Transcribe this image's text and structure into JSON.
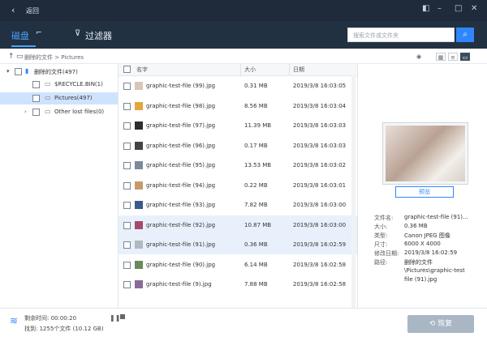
{
  "window": {
    "title": "返回"
  },
  "toolbar": {
    "scan_tab": "磁盘",
    "filter_tab": "过滤器",
    "search_placeholder": "搜索文件或文件夹"
  },
  "breadcrumb": {
    "path": "删除的文件 > Pictures"
  },
  "tree": [
    {
      "label": "删除的文件(497)"
    },
    {
      "label": "$RECYCLE.BIN(1)"
    },
    {
      "label": "Pictures(497)"
    },
    {
      "label": "Other lost files(0)"
    }
  ],
  "filelist": {
    "headers": {
      "name": "名字",
      "size": "大小",
      "date": "日期"
    },
    "rows": [
      {
        "name": "graphic-test-file (99).jpg",
        "size": "0.31 MB",
        "date": "2019/3/8 16:03:05"
      },
      {
        "name": "graphic-test-file (98).jpg",
        "size": "8.56 MB",
        "date": "2019/3/8 16:03:04"
      },
      {
        "name": "graphic-test-file (97).jpg",
        "size": "11.39 MB",
        "date": "2019/3/8 16:03:03"
      },
      {
        "name": "graphic-test-file (96).jpg",
        "size": "0.17 MB",
        "date": "2019/3/8 16:03:03"
      },
      {
        "name": "graphic-test-file (95).jpg",
        "size": "13.53 MB",
        "date": "2019/3/8 16:03:02"
      },
      {
        "name": "graphic-test-file (94).jpg",
        "size": "0.22 MB",
        "date": "2019/3/8 16:03:01"
      },
      {
        "name": "graphic-test-file (93).jpg",
        "size": "7.82 MB",
        "date": "2019/3/8 16:03:00"
      },
      {
        "name": "graphic-test-file (92).jpg",
        "size": "10.87 MB",
        "date": "2019/3/8 16:03:00"
      },
      {
        "name": "graphic-test-file (91).jpg",
        "size": "0.36 MB",
        "date": "2019/3/8 16:02:59"
      },
      {
        "name": "graphic-test-file (90).jpg",
        "size": "6.14 MB",
        "date": "2019/3/8 16:02:58"
      },
      {
        "name": "graphic-test-file (9).jpg",
        "size": "7.88 MB",
        "date": "2019/3/8 16:02:58"
      }
    ]
  },
  "preview": {
    "button": "预览",
    "info": [
      {
        "k": "文件名:",
        "v": "graphic-test-file (91)..."
      },
      {
        "k": "大小:",
        "v": "0.36 MB"
      },
      {
        "k": "类型:",
        "v": "Canon JPEG 图像"
      },
      {
        "k": "尺寸:",
        "v": "6000 X 4000"
      },
      {
        "k": "修改日期:",
        "v": "2019/3/8 16:02:59"
      },
      {
        "k": "路径:",
        "v": "删除的文件"
      },
      {
        "k": "",
        "v": "\\Pictures\\graphic-test"
      },
      {
        "k": "",
        "v": "file (91).jpg"
      }
    ]
  },
  "status": {
    "elapsed": "剩余时间: 00:00:20",
    "found": "找到: 1255个文件 (10.12 GB)"
  },
  "actions": {
    "recover": "恢复"
  }
}
